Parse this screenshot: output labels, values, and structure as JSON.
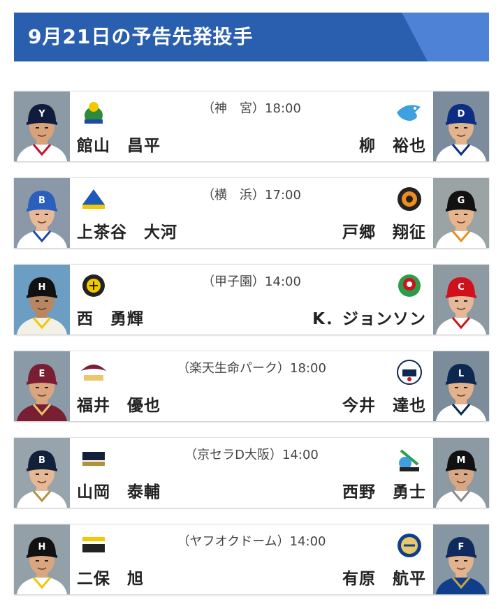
{
  "header": {
    "title": "9月21日の予告先発投手"
  },
  "games": [
    {
      "venue_time": "（神　宮）18:00",
      "home": {
        "pitcher": "館山　昌平",
        "cap": "#101c3c",
        "cap_mark": "Y",
        "jersey": "#ffffff",
        "trim": "#c8102e",
        "skin": "#d8a27a",
        "bg": "#8c9aa6"
      },
      "away": {
        "pitcher": "柳　裕也",
        "cap": "#0b2d82",
        "cap_mark": "D",
        "jersey": "#ffffff",
        "trim": "#0b2d82",
        "skin": "#e2b48e",
        "bg": "#7c8c9c"
      }
    },
    {
      "venue_time": "（横　浜）17:00",
      "home": {
        "pitcher": "上茶谷　大河",
        "cap": "#2a5fbe",
        "cap_mark": "B",
        "jersey": "#ffffff",
        "trim": "#1c4aa6",
        "skin": "#e8b998",
        "bg": "#8a98a8"
      },
      "away": {
        "pitcher": "戸郷　翔征",
        "cap": "#111111",
        "cap_mark": "G",
        "jersey": "#ffffff",
        "trim": "#f08c1c",
        "skin": "#e6b58e",
        "bg": "#9aa4a4"
      }
    },
    {
      "venue_time": "（甲子園）14:00",
      "home": {
        "pitcher": "西　勇輝",
        "cap": "#111111",
        "cap_mark": "H",
        "jersey": "#f3f1e6",
        "trim": "#f2c800",
        "skin": "#b98662",
        "bg": "#6c9ec4"
      },
      "away": {
        "pitcher": "K．ジョンソン",
        "cap": "#d0111b",
        "cap_mark": "C",
        "jersey": "#ffffff",
        "trim": "#d0111b",
        "skin": "#e5b89a",
        "bg": "#8e9aa2"
      }
    },
    {
      "venue_time": "（楽天生命パーク）18:00",
      "home": {
        "pitcher": "福井　優也",
        "cap": "#7a1f33",
        "cap_mark": "E",
        "jersey": "#7a1f33",
        "trim": "#e8c86a",
        "skin": "#d9a57e",
        "bg": "#8a9aa6"
      },
      "away": {
        "pitcher": "今井　達也",
        "cap": "#0c2750",
        "cap_mark": "L",
        "jersey": "#ffffff",
        "trim": "#0c2750",
        "skin": "#e3b28c",
        "bg": "#7c8c9a"
      }
    },
    {
      "venue_time": "（京セラD大阪）14:00",
      "home": {
        "pitcher": "山岡　泰輔",
        "cap": "#13203a",
        "cap_mark": "B",
        "jersey": "#ffffff",
        "trim": "#b3913b",
        "skin": "#e6b896",
        "bg": "#98a4ac"
      },
      "away": {
        "pitcher": "西野　勇士",
        "cap": "#111111",
        "cap_mark": "M",
        "jersey": "#ffffff",
        "trim": "#8a8a8a",
        "skin": "#d8a884",
        "bg": "#8c9aa4"
      }
    },
    {
      "venue_time": "（ヤフオクドーム）14:00",
      "home": {
        "pitcher": "二保　旭",
        "cap": "#111111",
        "cap_mark": "H",
        "jersey": "#ffffff",
        "trim": "#f2c800",
        "skin": "#d9a680",
        "bg": "#94a0a8"
      },
      "away": {
        "pitcher": "有原　航平",
        "cap": "#0f2a5c",
        "cap_mark": "F",
        "jersey": "#0f3f8a",
        "trim": "#c8a24a",
        "skin": "#e3b28e",
        "bg": "#8696a2"
      }
    }
  ],
  "team_logos": [
    {
      "home": "swallows-logo",
      "away": "dragons-logo"
    },
    {
      "home": "baystars-logo",
      "away": "giants-logo"
    },
    {
      "home": "tigers-logo",
      "away": "carp-logo"
    },
    {
      "home": "eagles-logo",
      "away": "lions-logo"
    },
    {
      "home": "buffaloes-logo",
      "away": "marines-logo"
    },
    {
      "home": "hawks-logo",
      "away": "fighters-logo"
    }
  ]
}
